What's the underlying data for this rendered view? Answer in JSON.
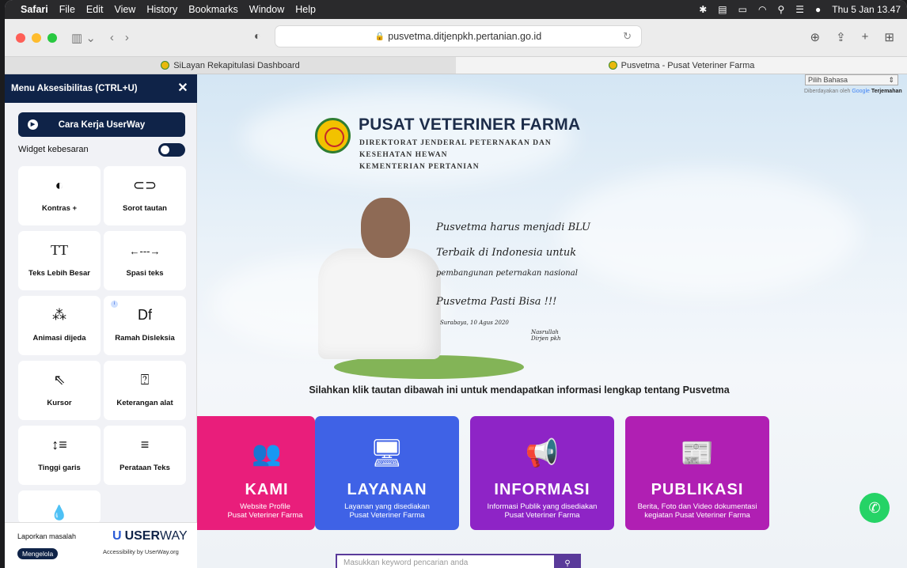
{
  "menubar": {
    "app": "Safari",
    "items": [
      "File",
      "Edit",
      "View",
      "History",
      "Bookmarks",
      "Window",
      "Help"
    ],
    "datetime": "Thu 5 Jan 13.47"
  },
  "toolbar": {
    "url": "pusvetma.ditjenpkh.pertanian.go.id"
  },
  "tabs": [
    {
      "title": "SiLayan Rekapitulasi Dashboard"
    },
    {
      "title": "Pusvetma - Pusat Veteriner Farma"
    }
  ],
  "translate": {
    "select_label": "Pilih Bahasa",
    "powered_prefix": "Diberdayakan oleh",
    "google": "Google",
    "powered_suffix": "Terjemahan"
  },
  "header": {
    "title": "PUSAT VETERINER FARMA",
    "line1": "DIREKTORAT JENDERAL PETERNAKAN DAN",
    "line2": "KESEHATAN HEWAN",
    "line3": "KEMENTERIAN PERTANIAN"
  },
  "handwriting": {
    "l1": "Pusvetma harus menjadi BLU",
    "l2": "Terbaik di Indonesia untuk",
    "l3": "pembangunan peternakan nasional",
    "l4": "Pusvetma Pasti Bisa !!!",
    "date": "Surabaya, 10 Agus 2020",
    "signer1": "Nasrullah",
    "signer2": "Dirjen pkh"
  },
  "prompt": "Silahkan klik tautan dibawah ini untuk mendapatkan informasi lengkap tentang Pusvetma",
  "cards": [
    {
      "title": "KAMI",
      "d1": "Website Profile",
      "d2": "Pusat Veteriner Farma",
      "color": "#e91e7b"
    },
    {
      "title": "LAYANAN",
      "d1": "Layanan yang disediakan",
      "d2": "Pusat Veteriner Farma",
      "color": "#3f62e6"
    },
    {
      "title": "INFORMASI",
      "d1": "Informasi Publik yang disediakan",
      "d2": "Pusat Veteriner Farma",
      "color": "#8e24c6"
    },
    {
      "title": "PUBLIKASI",
      "d1": "Berita, Foto dan Video dokumentasi",
      "d2": "kegiatan Pusat Veteriner Farma",
      "color": "#b01fb3"
    }
  ],
  "search": {
    "placeholder": "Masukkan keyword pencarian anda"
  },
  "userway": {
    "title": "Menu Aksesibilitas (CTRL+U)",
    "how": "Cara Kerja UserWay",
    "oversize": "Widget kebesaran",
    "tiles": [
      {
        "label": "Kontras +",
        "icon": "contrast-icon"
      },
      {
        "label": "Sorot tautan",
        "icon": "link-icon"
      },
      {
        "label": "Teks Lebih Besar",
        "icon": "text-size-icon"
      },
      {
        "label": "Spasi teks",
        "icon": "spacing-icon"
      },
      {
        "label": "Animasi dijeda",
        "icon": "pause-animation-icon"
      },
      {
        "label": "Ramah Disleksia",
        "icon": "dyslexia-icon"
      },
      {
        "label": "Kursor",
        "icon": "cursor-icon"
      },
      {
        "label": "Keterangan alat",
        "icon": "tooltip-icon"
      },
      {
        "label": "Tinggi garis",
        "icon": "line-height-icon"
      },
      {
        "label": "Perataan Teks",
        "icon": "text-align-icon"
      },
      {
        "label": "",
        "icon": "saturation-icon"
      }
    ],
    "report": "Laporkan masalah",
    "manage": "Mengelola",
    "brand_a": "USER",
    "brand_b": "WAY",
    "brand_sub": "Accessibility by UserWay.org"
  }
}
